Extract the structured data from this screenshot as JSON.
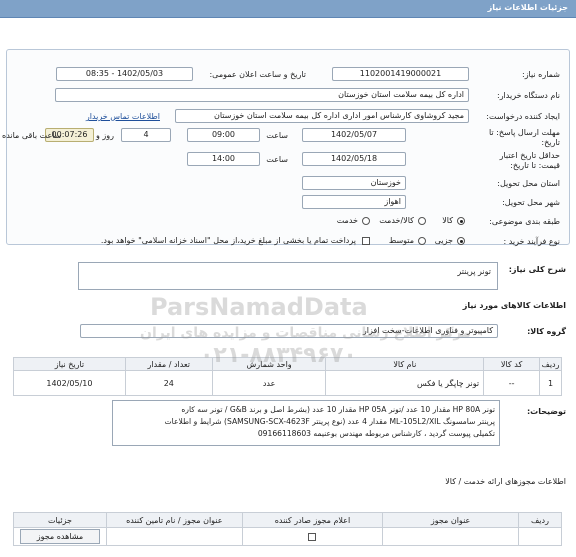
{
  "header": {
    "title": "جزئیات اطلاعات نیاز"
  },
  "form": {
    "need_number_label": "شماره نیاز:",
    "need_number": "1102001419000021",
    "announce_label": "تاریخ و ساعت اعلان عمومی:",
    "announce_value": "1402/05/03 - 08:35",
    "buyer_label": "نام دستگاه خریدار:",
    "buyer_value": "اداره کل بیمه سلامت استان خوزستان",
    "creator_label": "ایجاد کننده درخواست:",
    "creator_value": "مجید کروشاوی کارشناس امور اداری اداره کل بیمه سلامت استان خوزستان",
    "contact_link": "اطلاعات تماس خریدار",
    "deadline_label": "مهلت ارسال پاسخ: تا تاریخ:",
    "deadline_date": "1402/05/07",
    "time_label": "ساعت",
    "deadline_time": "09:00",
    "days": "4",
    "days_label": "روز و",
    "remaining": "00:07:26",
    "remaining_label": "ساعت باقی مانده",
    "min_price_label": "حداقل تاریخ اعتبار قیمت: تا تاریخ:",
    "min_price_date": "1402/05/18",
    "min_price_time_label": "ساعت",
    "min_price_time": "14:00",
    "province_label": "استان محل تحویل:",
    "province_value": "خوزستان",
    "city_label": "شهر محل تحویل:",
    "city_value": "اهواز",
    "category_label": "طبقه بندی موضوعی:",
    "category_options": [
      "کالا",
      "کالا/خدمت",
      "خدمت"
    ],
    "category_selected": "کالا",
    "process_label": "نوع فرآیند خرید :",
    "process_options": [
      "جزیی",
      "متوسط"
    ],
    "process_selected": "جزیی",
    "payment_note": "پرداخت تمام یا بخشی از مبلغ خرید،از محل \"اسناد خزانه اسلامی\" خواهد بود."
  },
  "need": {
    "summary_label": "شرح کلی نیاز:",
    "summary_value": "تونر پرینتر",
    "items_title": "اطلاعات کالاهای مورد نیاز",
    "group_label": "گروه کالا:",
    "group_value": "کامپیوتر و فناوری اطلاعات-سخت افزار"
  },
  "items_table": {
    "headers": [
      "ردیف",
      "کد کالا",
      "نام کالا",
      "واحد شمارش",
      "تعداد / مقدار",
      "تاریخ نیاز"
    ],
    "rows": [
      {
        "row": "1",
        "code": "--",
        "name": "تونر چاپگر یا فکس",
        "unit": "عدد",
        "qty": "24",
        "date": "1402/05/10"
      }
    ]
  },
  "description": {
    "label": "توضیحات:",
    "line1": "تونر HP 80A مقدار 10 عدد /تونر HP 05A مقدار 10 عدد (بشرط اصل و برند G&B /  تونر سه کاره",
    "line2": "پرینتر سامسونگ ML-105L2/XIL مقدار 4 عدد (نوع پرینتر SAMSUNG-SCX-4623F)  شرایط و اطلاعات",
    "line3": "تکمیلی پیوست گردید ، کارشناس مربوطه  مهندس بوعنیمه 09166118603"
  },
  "services": {
    "title": "اطلاعات مجوزهای ارائه خدمت / کالا",
    "headers": [
      "ردیف",
      "عنوان مجوز",
      "اعلام مجوز صادر کننده",
      "عنوان مجوز / نام تامین کننده",
      "جزئیات"
    ],
    "view_button": "مشاهده مجوز"
  },
  "watermark": {
    "brand": "ParsNamadData",
    "line_fa": "مرکز اطلاع رسانی مناقصات و مزایده های ایران",
    "phone": "۰۲۱-۸۸۳۴۹۶۷۰"
  },
  "colors": {
    "header_bg": "#7fa2c8",
    "timer_bg": "#f4f0d6",
    "link": "#1f4f9a"
  }
}
